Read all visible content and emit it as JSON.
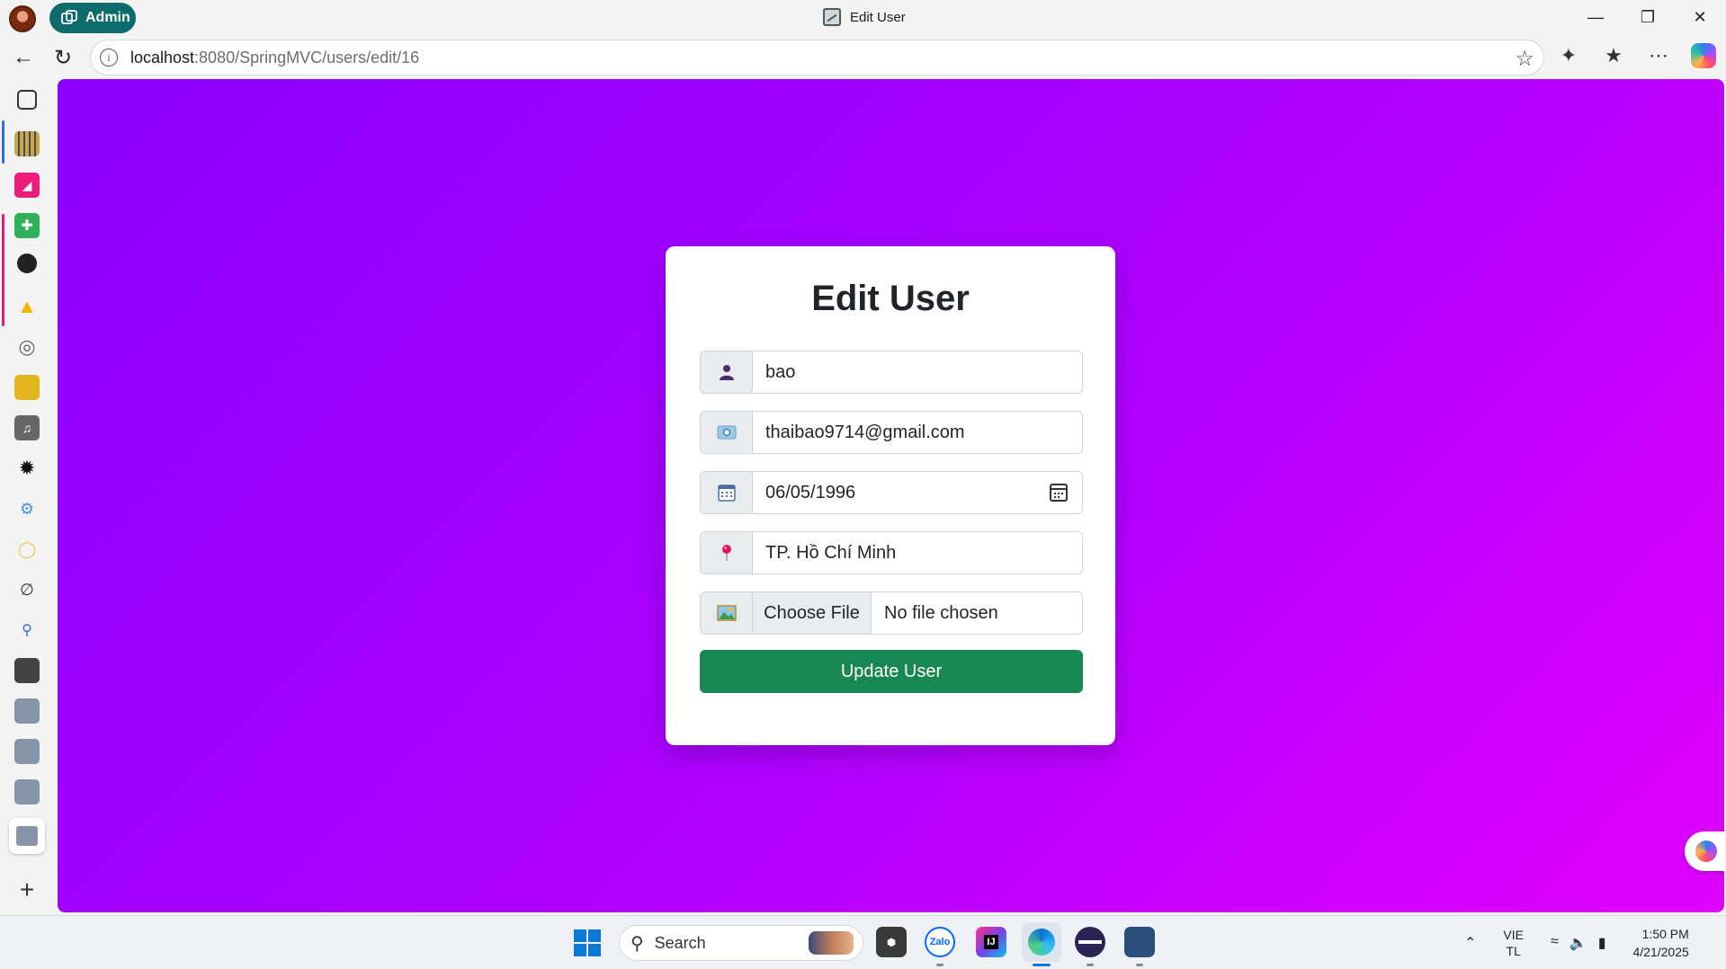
{
  "browser": {
    "window_title": "Edit User",
    "workspace_label": "Admin",
    "url_host": "localhost",
    "url_rest": ":8080/SpringMVC/users/edit/16",
    "toolbar_icons": [
      "extensions-icon",
      "favorites-icon",
      "more-icon",
      "copilot-icon"
    ]
  },
  "sidebar": {
    "items": [
      "tab-actions-icon",
      "film-app-icon",
      "pink-app-icon",
      "sheets-icon",
      "github-icon",
      "drive-icon",
      "globe-icon",
      "contacts-icon",
      "tiktok-icon",
      "openai-icon",
      "translate-icon",
      "pay-icon",
      "perplexity-icon",
      "search-icon",
      "image-app-icon",
      "edit-user-tab-icon",
      "edit-user-tab-icon-2",
      "edit-user-tab-icon-3",
      "edit-user-tab-icon-active",
      "add-icon"
    ]
  },
  "page": {
    "title": "Edit User",
    "name_value": "bao",
    "email_value": "thaibao9714@gmail.com",
    "dob_value": "06/05/1996",
    "address_value": "TP. Hồ Chí Minh",
    "file_button_label": "Choose File",
    "file_status": "No file chosen",
    "submit_label": "Update User"
  },
  "taskbar": {
    "search_label": "Search",
    "apps": [
      "app-cube",
      "zalo",
      "intellij",
      "edge",
      "eclipse",
      "image-app"
    ],
    "zalo_label": "Zalo",
    "intellij_label": "IJ",
    "lang_line1": "VIE",
    "lang_line2": "TL",
    "time": "1:50 PM",
    "date": "4/21/2025"
  },
  "colors": {
    "gradient_start": "#8b00ff",
    "gradient_end": "#e000ff",
    "button_green": "#198754"
  }
}
